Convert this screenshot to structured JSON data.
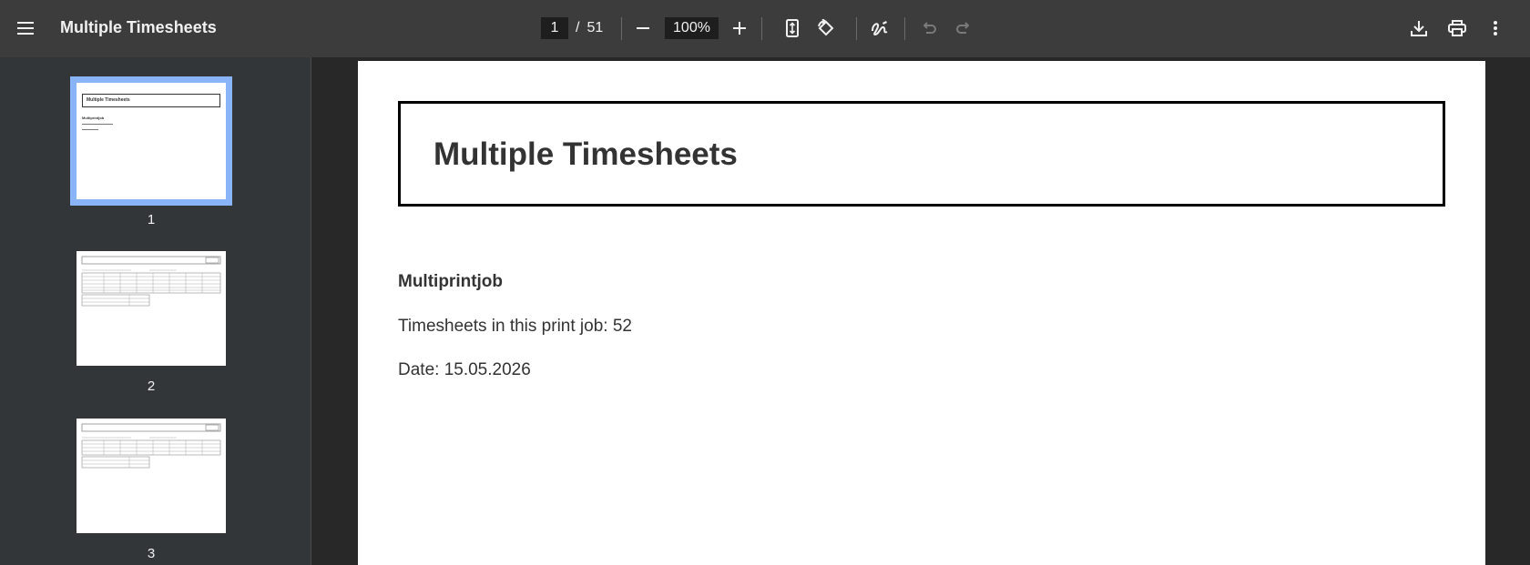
{
  "toolbar": {
    "title": "Multiple Timesheets",
    "current_page": "1",
    "separator": "/",
    "total_pages": "51",
    "zoom": "100%",
    "icons": [
      "menu-icon",
      "zoom-out-icon",
      "zoom-in-icon",
      "fit-page-icon",
      "rotate-icon",
      "annotate-icon",
      "undo-icon",
      "redo-icon",
      "download-icon",
      "print-icon",
      "more-icon"
    ]
  },
  "sidebar": {
    "thumbnails": [
      {
        "label": "1",
        "selected": true,
        "mini_title": "Multiple Timesheets",
        "mini_heading": "Multiprintjob"
      },
      {
        "label": "2",
        "selected": false
      },
      {
        "label": "3",
        "selected": false
      }
    ]
  },
  "document": {
    "title": "Multiple Timesheets",
    "heading": "Multiprintjob",
    "count_line": "Timesheets in this print job: 52",
    "date_line": "Date: 15.05.2026"
  },
  "colors": {
    "toolbar_bg": "#3c3c3c",
    "sidebar_bg": "#323639",
    "viewer_bg": "#282828",
    "selection": "#8ab4f8"
  }
}
